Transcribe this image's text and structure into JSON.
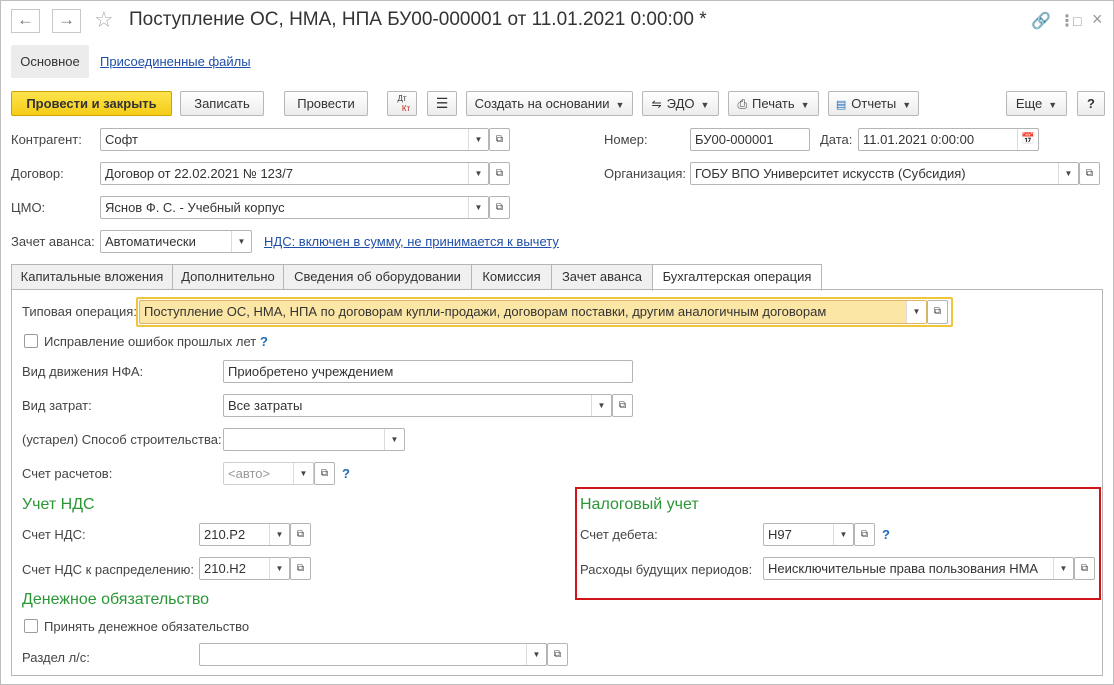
{
  "window": {
    "title": "Поступление ОС, НМА, НПА БУ00-000001 от 11.01.2021 0:00:00 *",
    "back_icon": "arrow-left-icon",
    "forward_icon": "arrow-right-icon",
    "favorite_icon": "star-icon",
    "link_icon": "link-icon",
    "more_icon": "vertical-dots-icon",
    "restore_icon": "restore-icon",
    "close_icon": "close-icon"
  },
  "sections": {
    "main": "Основное",
    "attached_files": "Присоединенные файлы"
  },
  "toolbar": {
    "post_close": "Провести и закрыть",
    "save": "Записать",
    "post": "Провести",
    "dt_kt_top": "Дт",
    "dt_kt_bottom": "Кт",
    "create_based_on": "Создать на основании",
    "edo": "ЭДО",
    "print": "Печать",
    "reports": "Отчеты",
    "more": "Еще",
    "help": "?"
  },
  "header": {
    "contractor_label": "Контрагент:",
    "contractor_value": "Софт",
    "contract_label": "Договор:",
    "contract_value": "Договор от 22.02.2021 № 123/7",
    "cmo_label": "ЦМО:",
    "cmo_value": "Яснов Ф. С. - Учебный корпус",
    "advance_label": "Зачет аванса:",
    "advance_value": "Автоматически",
    "vat_link": "НДС: включен в сумму, не принимается к вычету",
    "number_label": "Номер:",
    "number_value": "БУ00-000001",
    "date_label": "Дата:",
    "date_value": "11.01.2021  0:00:00",
    "org_label": "Организация:",
    "org_value": "ГОБУ ВПО Университет искусств (Субсидия)"
  },
  "tabs": [
    {
      "label": "Капитальные вложения"
    },
    {
      "label": "Дополнительно"
    },
    {
      "label": "Сведения об оборудовании"
    },
    {
      "label": "Комиссия"
    },
    {
      "label": "Зачет аванса"
    },
    {
      "label": "Бухгалтерская операция"
    }
  ],
  "operation": {
    "typical_label": "Типовая операция:",
    "typical_value": "Поступление ОС, НМА, НПА по договорам купли-продажи, договорам поставки, другим аналогичным договорам",
    "fix_errors_label": "Исправление ошибок прошлых лет",
    "fix_errors_checked": false,
    "help": "?",
    "nfa_label": "Вид движения НФА:",
    "nfa_value": "Приобретено учреждением",
    "costs_label": "Вид затрат:",
    "costs_value": "Все затраты",
    "build_label": "(устарел) Способ строительства:",
    "build_value": "",
    "account_label": "Счет расчетов:",
    "account_placeholder": "<авто>"
  },
  "vat": {
    "title": "Учет НДС",
    "vat_account_label": "Счет НДС:",
    "vat_account_value": "210.Р2",
    "vat_dist_label": "Счет НДС к распределению:",
    "vat_dist_value": "210.Н2"
  },
  "monetary": {
    "title": "Денежное обязательство",
    "accept_label": "Принять денежное обязательство",
    "accept_checked": false,
    "section_label": "Раздел л/с:",
    "section_value": ""
  },
  "tax": {
    "title": "Налоговый учет",
    "debit_label": "Счет дебета:",
    "debit_value": "Н97",
    "future_label": "Расходы будущих периодов:",
    "future_value": "Неисключительные права пользования НМА",
    "help": "?"
  },
  "colors": {
    "accent_yellow": "#f5cd17",
    "highlight_border": "#d0141a",
    "group_green": "#2a9636",
    "link_blue": "#1f4fa8"
  }
}
